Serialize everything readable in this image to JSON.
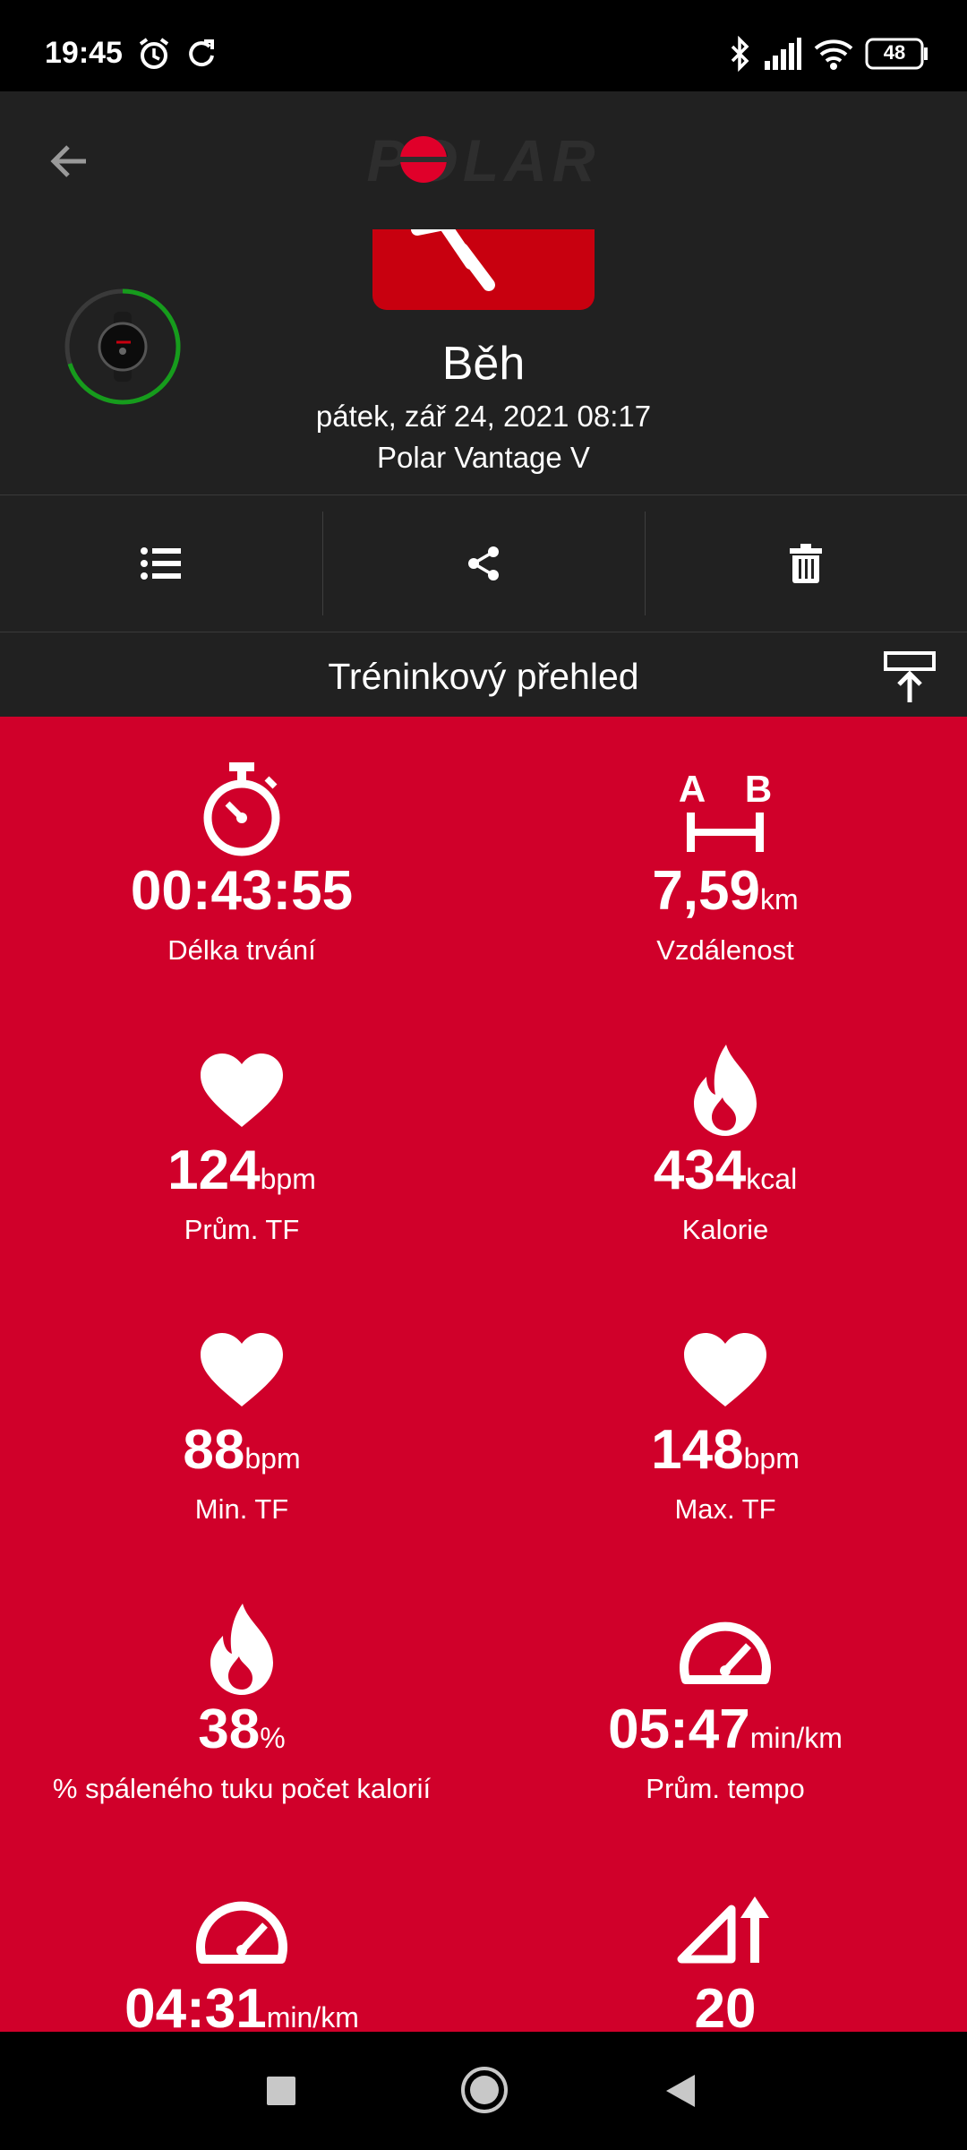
{
  "status_bar": {
    "time": "19:45",
    "battery": "48"
  },
  "header": {
    "sport": "Běh",
    "date": "pátek, zář 24, 2021 08:17",
    "device": "Polar Vantage V"
  },
  "section": {
    "title": "Tréninkový přehled"
  },
  "stats": [
    {
      "value": "00:43:55",
      "unit": "",
      "label": "Délka trvání",
      "icon": "stopwatch-icon"
    },
    {
      "value": "7,59",
      "unit": "km",
      "label": "Vzdálenost",
      "icon": "distance-ab-icon"
    },
    {
      "value": "124",
      "unit": "bpm",
      "label": "Prům. TF",
      "icon": "heart-icon"
    },
    {
      "value": "434",
      "unit": "kcal",
      "label": "Kalorie",
      "icon": "flame-icon"
    },
    {
      "value": "88",
      "unit": "bpm",
      "label": "Min. TF",
      "icon": "heart-icon"
    },
    {
      "value": "148",
      "unit": "bpm",
      "label": "Max. TF",
      "icon": "heart-icon"
    },
    {
      "value": "38",
      "unit": "%",
      "label": "% spáleného tuku počet kalorií",
      "icon": "flame-icon"
    },
    {
      "value": "05:47",
      "unit": "min/km",
      "label": "Prům. tempo",
      "icon": "speedometer-icon"
    },
    {
      "value": "04:31",
      "unit": "min/km",
      "label": "",
      "icon": "speedometer-icon"
    },
    {
      "value": "20",
      "unit": "",
      "label": "",
      "icon": "ascent-icon"
    }
  ],
  "colors": {
    "accent": "#d0002a",
    "panel": "#212121",
    "tile": "#c8000f"
  }
}
